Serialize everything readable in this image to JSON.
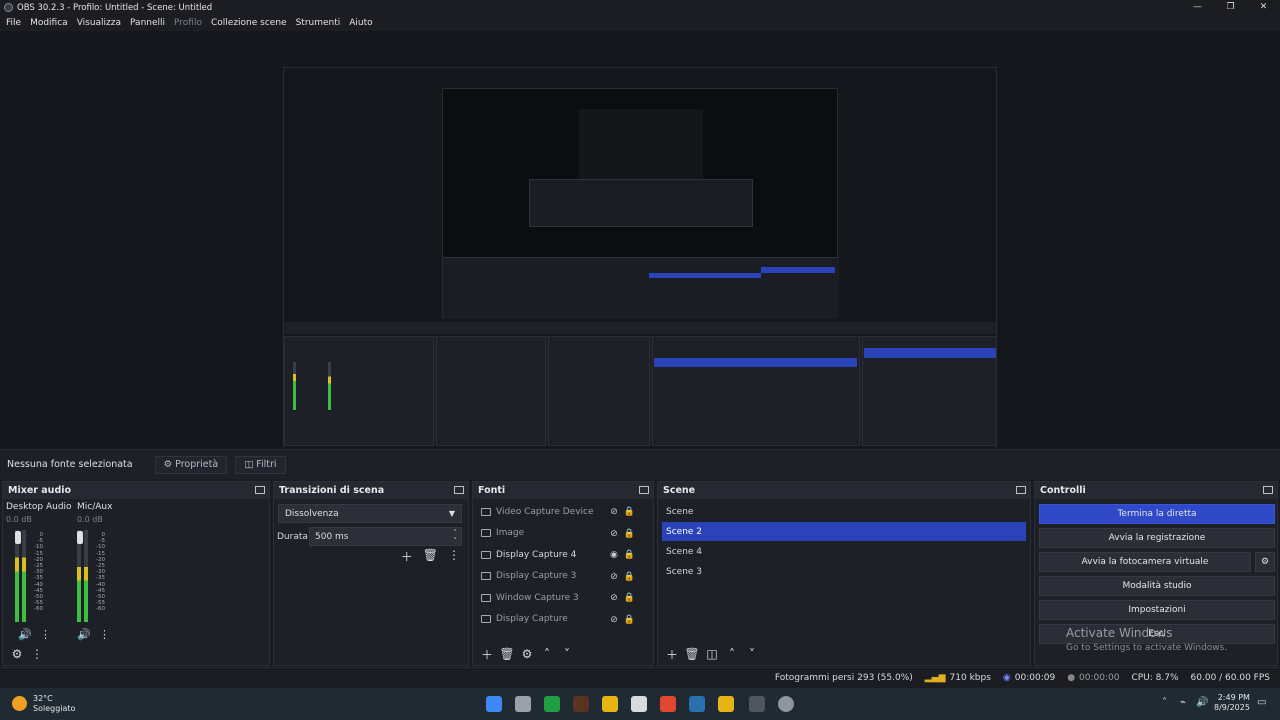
{
  "window": {
    "title": "OBS 30.2.3 - Profilo: Untitled - Scene: Untitled",
    "controls": [
      "—",
      "❐",
      "✕"
    ]
  },
  "menu": [
    "File",
    "Modifica",
    "Visualizza",
    "Pannelli",
    "Profilo",
    "Collezione scene",
    "Strumenti",
    "Aiuto"
  ],
  "source_bar": {
    "label": "Nessuna fonte selezionata",
    "properties": "Proprietà",
    "filters": "Filtri"
  },
  "mixer": {
    "title": "Mixer audio",
    "channels": [
      {
        "name": "Desktop Audio",
        "db": "0.0 dB",
        "level": 0.55
      },
      {
        "name": "Mic/Aux",
        "db": "0.0 dB",
        "level": 0.45
      }
    ],
    "scale": [
      "0",
      "-5",
      "-10",
      "-15",
      "-20",
      "-25",
      "-30",
      "-35",
      "-40",
      "-45",
      "-50",
      "-55",
      "-60"
    ]
  },
  "transitions": {
    "title": "Transizioni di scena",
    "selected": "Dissolvenza",
    "duration_label": "Durata",
    "duration_value": "500 ms"
  },
  "sources": {
    "title": "Fonti",
    "items": [
      {
        "name": "Video Capture Device",
        "visible": false
      },
      {
        "name": "Image",
        "visible": false
      },
      {
        "name": "Display Capture 4",
        "visible": true
      },
      {
        "name": "Display Capture 3",
        "visible": false
      },
      {
        "name": "Window Capture 3",
        "visible": false
      },
      {
        "name": "Display Capture",
        "visible": false
      }
    ]
  },
  "scenes": {
    "title": "Scene",
    "items": [
      "Scene",
      "Scene 2",
      "Scene 4",
      "Scene 3"
    ],
    "selected": "Scene 2"
  },
  "controls": {
    "title": "Controlli",
    "buttons": [
      "Termina la diretta",
      "Avvia la registrazione",
      "Avvia la fotocamera virtuale",
      "Modalità studio",
      "Impostazioni",
      "Esci"
    ]
  },
  "watermark": {
    "line1": "Activate Windows",
    "line2": "Go to Settings to activate Windows."
  },
  "status": {
    "dropped": "Fotogrammi persi 293 (55.0%)",
    "bitrate": "710 kbps",
    "stream_time": "00:00:09",
    "rec_time": "00:00:00",
    "cpu": "CPU: 8.7%",
    "fps": "60.00 / 60.00 FPS"
  },
  "taskbar": {
    "weather_temp": "32°C",
    "weather_desc": "Soleggiato",
    "time": "2:49 PM",
    "date": "8/9/2025"
  },
  "colors": {
    "accent": "#2f49c9",
    "selected": "#2a43b8",
    "meter_green": "#3fbf3f",
    "meter_yellow": "#d9c020"
  }
}
